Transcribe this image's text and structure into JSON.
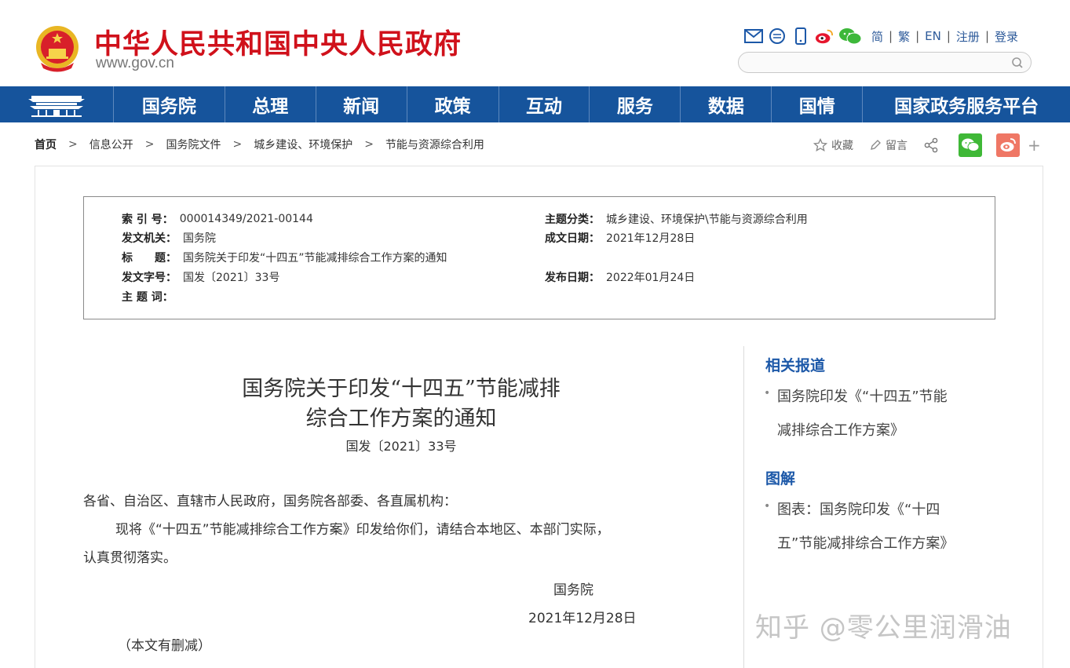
{
  "header": {
    "title": "中华人民共和国中央人民政府",
    "url": "www.gov.cn",
    "tool_icons": [
      "mail-icon",
      "chat-bubble-icon",
      "mobile-icon",
      "weibo-icon",
      "wechat-icon"
    ],
    "langs": [
      "简",
      "繁",
      "EN",
      "注册",
      "登录"
    ],
    "search": {
      "placeholder": ""
    }
  },
  "nav": {
    "items": [
      "国务院",
      "总理",
      "新闻",
      "政策",
      "互动",
      "服务",
      "数据",
      "国情",
      "国家政务服务平台"
    ],
    "color": "#16549c"
  },
  "breadcrumb": {
    "home": "首页",
    "items": [
      "信息公开",
      "国务院文件",
      "城乡建设、环境保护",
      "节能与资源综合利用"
    ]
  },
  "share": {
    "collect": "收藏",
    "comment": "留言"
  },
  "meta": {
    "index_label": "索 引 号：",
    "index_value": "000014349/2021-00144",
    "category_label": "主题分类：",
    "category_value": "城乡建设、环境保护\\节能与资源综合利用",
    "issuer_label": "发文机关：",
    "issuer_value": "国务院",
    "date_written_label": "成文日期：",
    "date_written_value": "2021年12月28日",
    "title_label": "标　　题：",
    "title_value": "国务院关于印发“十四五”节能减排综合工作方案的通知",
    "docnum_label": "发文字号：",
    "docnum_value": "国发〔2021〕33号",
    "pubdate_label": "发布日期：",
    "pubdate_value": "2022年01月24日",
    "keywords_label": "主 题 词：",
    "keywords_value": ""
  },
  "article": {
    "title_line1": "国务院关于印发“十四五”节能减排",
    "title_line2": "综合工作方案的通知",
    "doc_number": "国发〔2021〕33号",
    "salutation": "各省、自治区、直辖市人民政府，国务院各部委、各直属机构：",
    "body_line1": "现将《“十四五”节能减排综合工作方案》印发给你们，请结合本地区、本部门实际，",
    "body_line2": "认真贯彻落实。",
    "signer": "国务院",
    "date": "2021年12月28日",
    "note": "（本文有删减）"
  },
  "sidebar": {
    "related_title": "相关报道",
    "related_line1": "国务院印发《“十四五”节能",
    "related_line2": "减排综合工作方案》",
    "graphic_title": "图解",
    "graphic_line1": "图表：国务院印发《“十四",
    "graphic_line2": "五”节能减排综合工作方案》"
  },
  "watermark": "知乎 @零公里润滑油"
}
